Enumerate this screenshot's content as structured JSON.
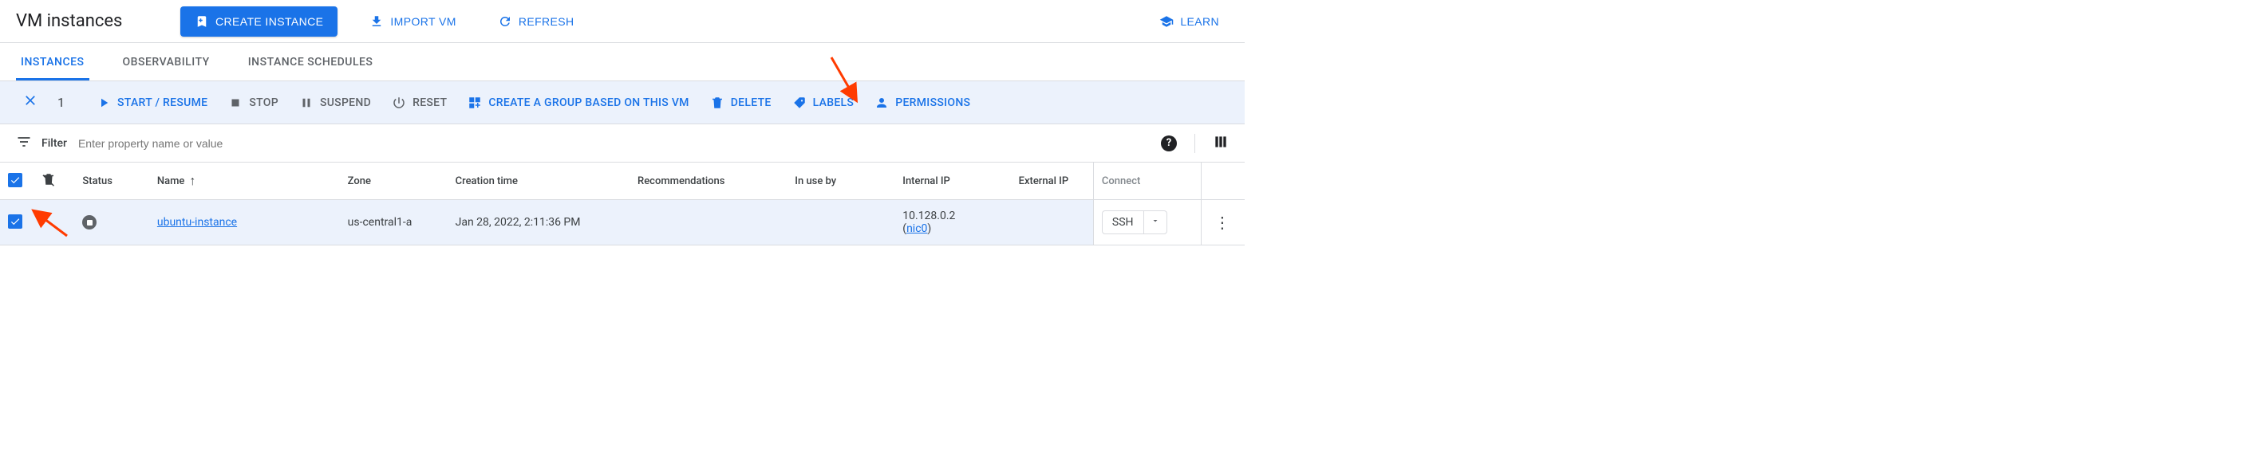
{
  "header": {
    "title": "VM instances",
    "create_label": "CREATE INSTANCE",
    "import_label": "IMPORT VM",
    "refresh_label": "REFRESH",
    "learn_label": "LEARN"
  },
  "tabs": {
    "instances": "INSTANCES",
    "observability": "OBSERVABILITY",
    "schedules": "INSTANCE SCHEDULES"
  },
  "selection": {
    "count": "1",
    "start": "START / RESUME",
    "stop": "STOP",
    "suspend": "SUSPEND",
    "reset": "RESET",
    "group": "CREATE A GROUP BASED ON THIS VM",
    "delete": "DELETE",
    "labels": "LABELS",
    "permissions": "PERMISSIONS"
  },
  "filter": {
    "label": "Filter",
    "placeholder": "Enter property name or value"
  },
  "columns": {
    "status": "Status",
    "name": "Name",
    "zone": "Zone",
    "creation": "Creation time",
    "recommendations": "Recommendations",
    "inuse": "In use by",
    "internal": "Internal IP",
    "external": "External IP",
    "connect": "Connect"
  },
  "row": {
    "name": "ubuntu-instance",
    "zone": "us-central1-a",
    "creation": "Jan 28, 2022, 2:11:36 PM",
    "internal_ip": "10.128.0.2",
    "nic": "nic0",
    "ssh": "SSH"
  }
}
